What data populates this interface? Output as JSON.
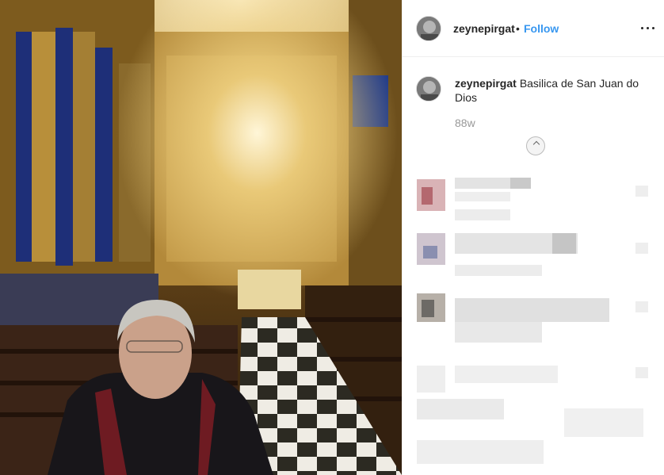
{
  "post": {
    "username": "zeynepirgat",
    "separator": "•",
    "follow_label": "Follow",
    "more_icon": "more-horizontal-icon",
    "caption_text": "Basilica de San Juan do Dios",
    "time_ago": "88w",
    "load_more_icon": "plus-circle-icon"
  },
  "colors": {
    "link_blue": "#3897f0",
    "text": "#262626",
    "muted": "#999999",
    "divider": "#efefef"
  }
}
